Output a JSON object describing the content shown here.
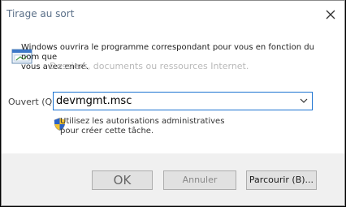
{
  "window": {
    "title": "Tirage au sort"
  },
  "description": {
    "line1": "Windows ouvrira le programme correspondant pour vous en fonction du nom que",
    "line2": "vous avez entré.",
    "ghost_hint": "Dossiers, documents ou ressources Internet."
  },
  "open": {
    "label": "Ouvert (Q):",
    "value": "devmgmt.msc"
  },
  "admin": {
    "line1": "Utilisez les autorisations administratives",
    "line2": "pour créer cette tâche."
  },
  "buttons": {
    "ok": "OK",
    "cancel": "Annuler",
    "browse": "Parcourir (B)..."
  },
  "colors": {
    "title_text": "#5a6f88",
    "focus_border": "#1c73d1",
    "footer_bg": "#f0f0f0"
  }
}
